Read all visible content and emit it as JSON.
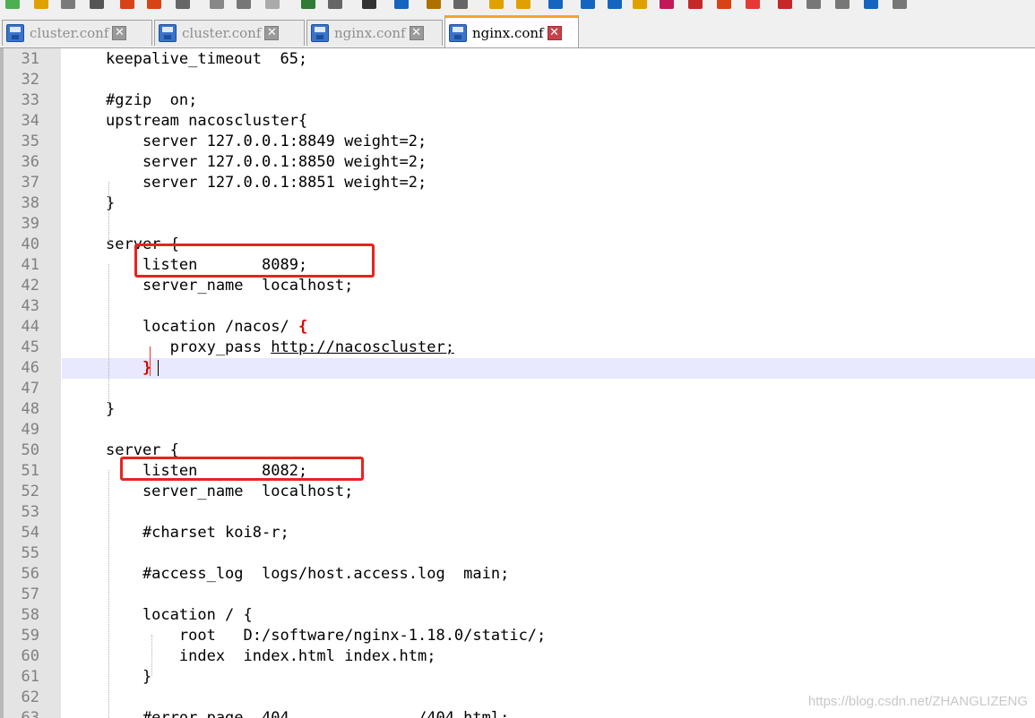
{
  "tabs": [
    {
      "label": "cluster.conf",
      "active": false
    },
    {
      "label": "cluster.conf",
      "active": false
    },
    {
      "label": "nginx.conf",
      "active": false
    },
    {
      "label": "nginx.conf",
      "active": true
    }
  ],
  "tab_close_glyph": "✕",
  "editor": {
    "lines": [
      {
        "n": "31",
        "text": "keepalive_timeout  65;"
      },
      {
        "n": "32",
        "text": ""
      },
      {
        "n": "33",
        "text": "#gzip  on;"
      },
      {
        "n": "34",
        "text": "upstream nacoscluster{"
      },
      {
        "n": "35",
        "text": "    server 127.0.0.1:8849 weight=2;"
      },
      {
        "n": "36",
        "text": "    server 127.0.0.1:8850 weight=2;"
      },
      {
        "n": "37",
        "text": "    server 127.0.0.1:8851 weight=2;"
      },
      {
        "n": "38",
        "text": "}"
      },
      {
        "n": "39",
        "text": ""
      },
      {
        "n": "40",
        "text": "server {"
      },
      {
        "n": "41",
        "text": "    listen       8089;"
      },
      {
        "n": "42",
        "text": "    server_name  localhost;"
      },
      {
        "n": "43",
        "text": ""
      },
      {
        "n": "44",
        "text": "    location /nacos/ ",
        "brace": "{"
      },
      {
        "n": "45",
        "text": "       proxy_pass ",
        "link": "http://nacoscluster;"
      },
      {
        "n": "46",
        "text": "    ",
        "brace": "}",
        "current": true
      },
      {
        "n": "47",
        "text": ""
      },
      {
        "n": "48",
        "text": "}"
      },
      {
        "n": "49",
        "text": ""
      },
      {
        "n": "50",
        "text": "server {"
      },
      {
        "n": "51",
        "text": "    listen       8082;"
      },
      {
        "n": "52",
        "text": "    server_name  localhost;"
      },
      {
        "n": "53",
        "text": ""
      },
      {
        "n": "54",
        "text": "    #charset koi8-r;"
      },
      {
        "n": "55",
        "text": ""
      },
      {
        "n": "56",
        "text": "    #access_log  logs/host.access.log  main;"
      },
      {
        "n": "57",
        "text": ""
      },
      {
        "n": "58",
        "text": "    location / {"
      },
      {
        "n": "59",
        "text": "        root   D:/software/nginx-1.18.0/static/;"
      },
      {
        "n": "60",
        "text": "        index  index.html index.htm;"
      },
      {
        "n": "61",
        "text": "    }"
      },
      {
        "n": "62",
        "text": ""
      },
      {
        "n": "63",
        "text": "    #error_page  404              /404.html;"
      }
    ]
  },
  "watermark": "https://blog.csdn.net/ZHANGLIZENG",
  "colors": {
    "highlight_box": "#e8231f",
    "brace_match": "#e00000",
    "current_line": "#e8e8ff",
    "active_tab_accent": "#f5a623"
  }
}
